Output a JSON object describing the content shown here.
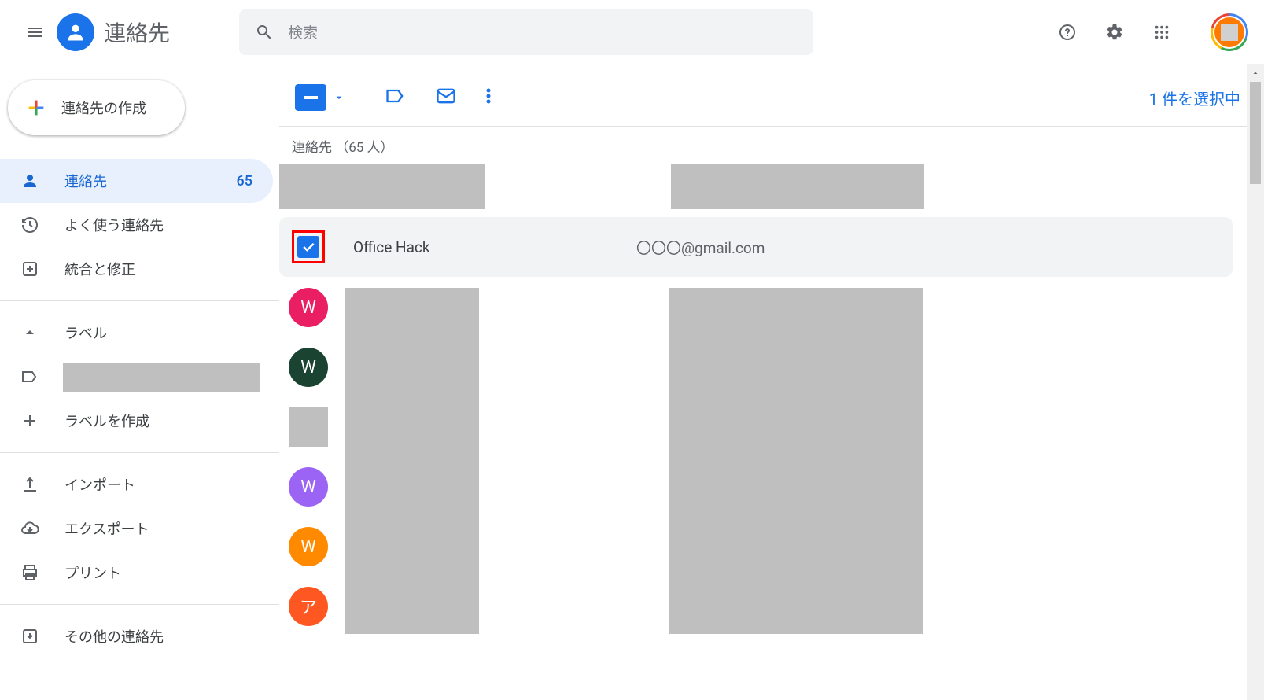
{
  "header": {
    "app_title": "連絡先",
    "search_placeholder": "検索"
  },
  "sidebar": {
    "create_label": "連絡先の作成",
    "items": {
      "contacts": {
        "label": "連絡先",
        "count": "65"
      },
      "frequent": {
        "label": "よく使う連絡先"
      },
      "merge": {
        "label": "統合と修正"
      },
      "labels_header": {
        "label": "ラベル"
      },
      "create_label": {
        "label": "ラベルを作成"
      },
      "import": {
        "label": "インポート"
      },
      "export": {
        "label": "エクスポート"
      },
      "print": {
        "label": "プリント"
      },
      "other": {
        "label": "その他の連絡先"
      }
    }
  },
  "toolbar": {
    "selection_text": "1 件を選択中"
  },
  "list": {
    "header": "連絡先 （65 人）",
    "selected_row": {
      "name": "Office Hack",
      "email": "〇〇〇@gmail.com"
    },
    "avatars": [
      {
        "letter": "W",
        "color": "#e91e63"
      },
      {
        "letter": "W",
        "color": "#1b4332"
      },
      {
        "letter": "",
        "color": ""
      },
      {
        "letter": "W",
        "color": "#9c64f4"
      },
      {
        "letter": "W",
        "color": "#ff8a00"
      },
      {
        "letter": "ア",
        "color": "#ff5722"
      }
    ]
  }
}
